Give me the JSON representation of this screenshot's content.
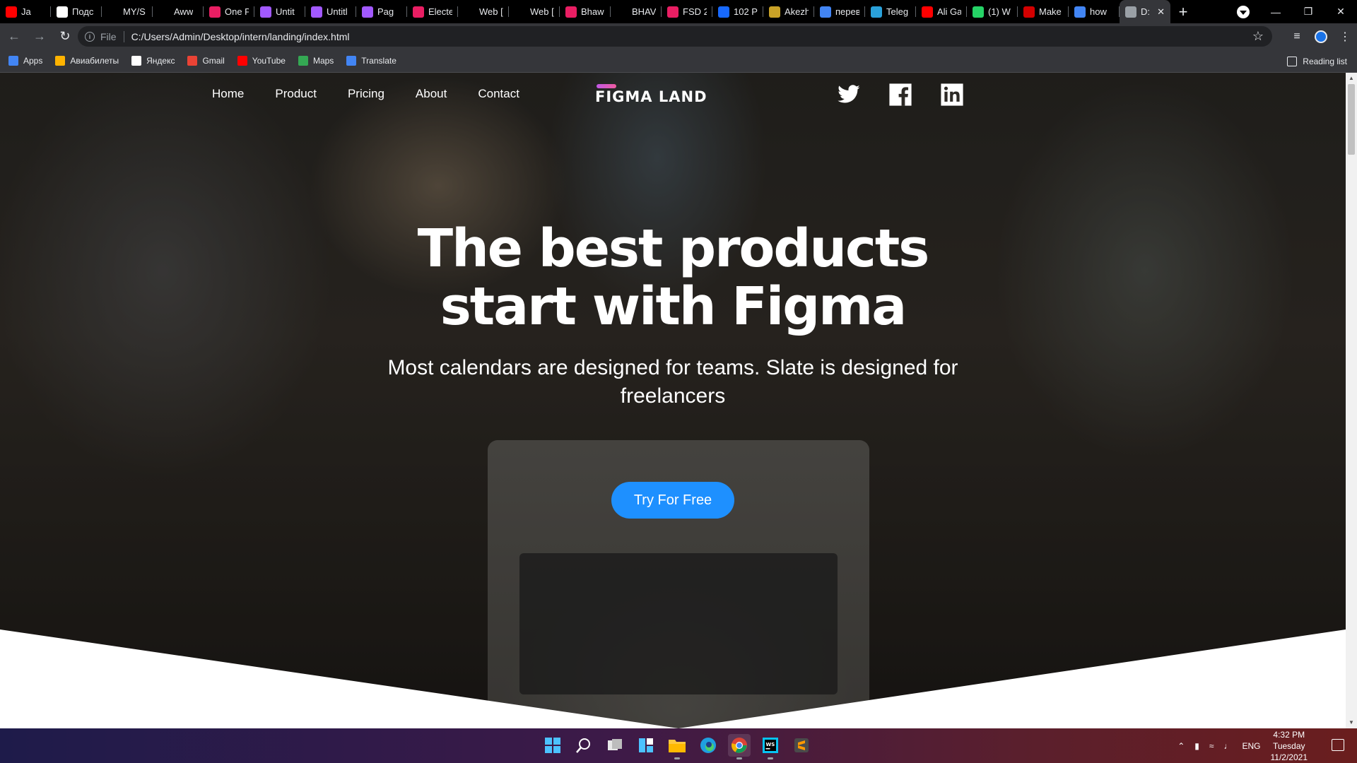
{
  "browser": {
    "tabs": [
      {
        "label": "Ja",
        "color": "#ff0000"
      },
      {
        "label": "Подс",
        "color": "#ffffff"
      },
      {
        "label": "MY/S",
        "color": "#000000"
      },
      {
        "label": "Aww",
        "color": "#000000"
      },
      {
        "label": "One P",
        "color": "#e91e63"
      },
      {
        "label": "Untit",
        "color": "#a259ff"
      },
      {
        "label": "Untitl",
        "color": "#a259ff"
      },
      {
        "label": "Pag",
        "color": "#a259ff"
      },
      {
        "label": "Electe",
        "color": "#e91e63"
      },
      {
        "label": "Web [",
        "color": "#000000"
      },
      {
        "label": "Web [",
        "color": "#000000"
      },
      {
        "label": "Bhaw",
        "color": "#e91e63"
      },
      {
        "label": "BHAV",
        "color": "#000000"
      },
      {
        "label": "FSD 2",
        "color": "#e91e63"
      },
      {
        "label": "102 P",
        "color": "#1769ff"
      },
      {
        "label": "Akezh",
        "color": "#c9a227"
      },
      {
        "label": "перев",
        "color": "#4285f4"
      },
      {
        "label": "Teleg",
        "color": "#2aa1da"
      },
      {
        "label": "Ali Ga",
        "color": "#ff0000"
      },
      {
        "label": "(1) W",
        "color": "#25d366"
      },
      {
        "label": "Make",
        "color": "#d30000"
      },
      {
        "label": "how",
        "color": "#4285f4"
      },
      {
        "label": "D:",
        "color": "#9aa0a6",
        "active": true
      }
    ],
    "address": {
      "scheme": "File",
      "url": "C:/Users/Admin/Desktop/intern/landing/index.html"
    },
    "bookmarks": [
      {
        "label": "Apps",
        "color": "#4285f4"
      },
      {
        "label": "Авиабилеты",
        "color": "#ffb300"
      },
      {
        "label": "Яндекс",
        "color": "#ffffff"
      },
      {
        "label": "Gmail",
        "color": "#ea4335"
      },
      {
        "label": "YouTube",
        "color": "#ff0000"
      },
      {
        "label": "Maps",
        "color": "#34a853"
      },
      {
        "label": "Translate",
        "color": "#4285f4"
      }
    ],
    "reading_list": "Reading list"
  },
  "site": {
    "nav": [
      "Home",
      "Product",
      "Pricing",
      "About",
      "Contact"
    ],
    "logo": "FIGMA LAND",
    "socials": [
      "twitter-icon",
      "facebook-icon",
      "linkedin-icon"
    ],
    "hero": {
      "title_line1": "The best products",
      "title_line2": "start with Figma",
      "subtitle": "Most calendars are designed for teams. Slate is designed for freelancers",
      "cta": "Try For Free"
    },
    "accent_color": "#1e90ff"
  },
  "taskbar": {
    "apps": [
      "start-icon",
      "search-icon",
      "task-view-icon",
      "widgets-icon",
      "file-explorer-icon",
      "edge-icon",
      "chrome-icon",
      "webstorm-icon",
      "sublime-icon"
    ],
    "language": "ENG",
    "time": "4:32 PM",
    "day": "Tuesday",
    "date": "11/2/2021"
  }
}
